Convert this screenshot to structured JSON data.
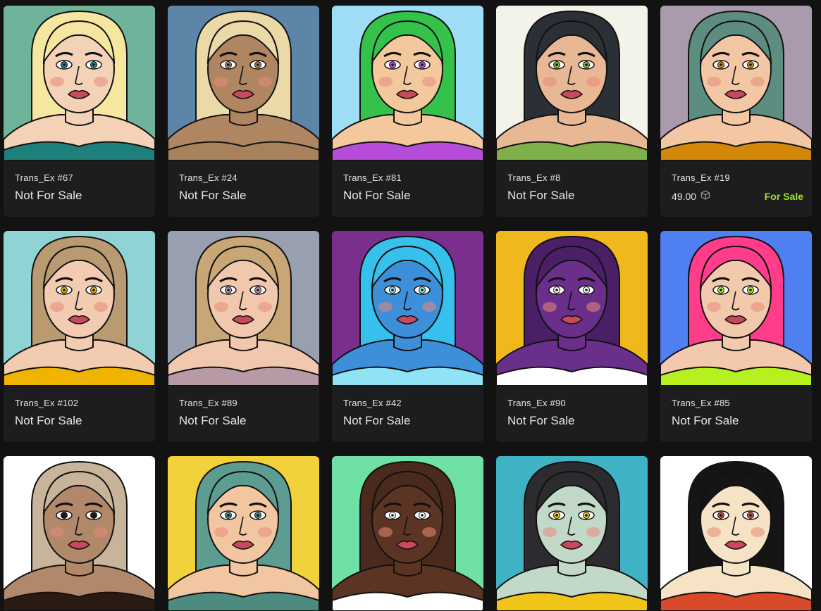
{
  "colors": {
    "page_bg": "#121212",
    "card_bg": "#1d1d1f",
    "text": "#e6e6e6",
    "for_sale": "#9ee32b"
  },
  "grid": {
    "rows": [
      [
        {
          "name": "Trans_Ex #67",
          "status": "Not For Sale",
          "bg": "#6fb39a",
          "skin": "#f3d2b8",
          "hair": "#f5e7a0",
          "accent": "#1f7f7a"
        },
        {
          "name": "Trans_Ex #24",
          "status": "Not For Sale",
          "bg": "#5c85a8",
          "skin": "#b08561",
          "hair": "#ecd9a8",
          "accent": "#a7825c"
        },
        {
          "name": "Trans_Ex #81",
          "status": "Not For Sale",
          "bg": "#9fdcf6",
          "skin": "#f2c89c",
          "hair": "#35c24a",
          "accent": "#b64cd9"
        },
        {
          "name": "Trans_Ex #8",
          "status": "Not For Sale",
          "bg": "#f3f3ea",
          "skin": "#e8b895",
          "hair": "#2b2f36",
          "accent": "#7fb04a"
        },
        {
          "name": "Trans_Ex #19",
          "price": "49.00",
          "price_icon": "cube-icon",
          "sale_label": "For Sale",
          "bg": "#a99aad",
          "skin": "#f4c7a4",
          "hair": "#5c8d80",
          "accent": "#d4880a"
        }
      ],
      [
        {
          "name": "Trans_Ex #102",
          "status": "Not For Sale",
          "bg": "#8fd3d5",
          "skin": "#f2cbb0",
          "hair": "#b99a71",
          "accent": "#f0b400"
        },
        {
          "name": "Trans_Ex #89",
          "status": "Not For Sale",
          "bg": "#98a0b0",
          "skin": "#f1c8ad",
          "hair": "#c9a676",
          "accent": "#b89aa6"
        },
        {
          "name": "Trans_Ex #42",
          "status": "Not For Sale",
          "bg": "#7a2f8f",
          "skin": "#3d8fd9",
          "hair": "#36c0ee",
          "accent": "#8fe3f5"
        },
        {
          "name": "Trans_Ex #90",
          "status": "Not For Sale",
          "bg": "#f0b81c",
          "skin": "#6a2f8a",
          "hair": "#4a1f66",
          "accent": "#ffffff"
        },
        {
          "name": "Trans_Ex #85",
          "status": "Not For Sale",
          "bg": "#4f7ff0",
          "skin": "#f3c9ad",
          "hair": "#ff3d8a",
          "accent": "#b6f01f"
        }
      ],
      [
        {
          "bg": "#ffffff",
          "skin": "#b2886b",
          "hair": "#c8b49a",
          "accent": "#2a1a12"
        },
        {
          "bg": "#f2d23a",
          "skin": "#f3c6a2",
          "hair": "#5d9c90",
          "accent": "#4d8a7f"
        },
        {
          "bg": "#6fe0a6",
          "skin": "#5b3424",
          "hair": "#4a2a1c",
          "accent": "#ffffff"
        },
        {
          "bg": "#3fb3c4",
          "skin": "#c3d9c8",
          "hair": "#2c2c30",
          "accent": "#f0c419"
        },
        {
          "bg": "#ffffff",
          "skin": "#f6e2c4",
          "hair": "#151515",
          "accent": "#d84a2a"
        }
      ]
    ]
  }
}
